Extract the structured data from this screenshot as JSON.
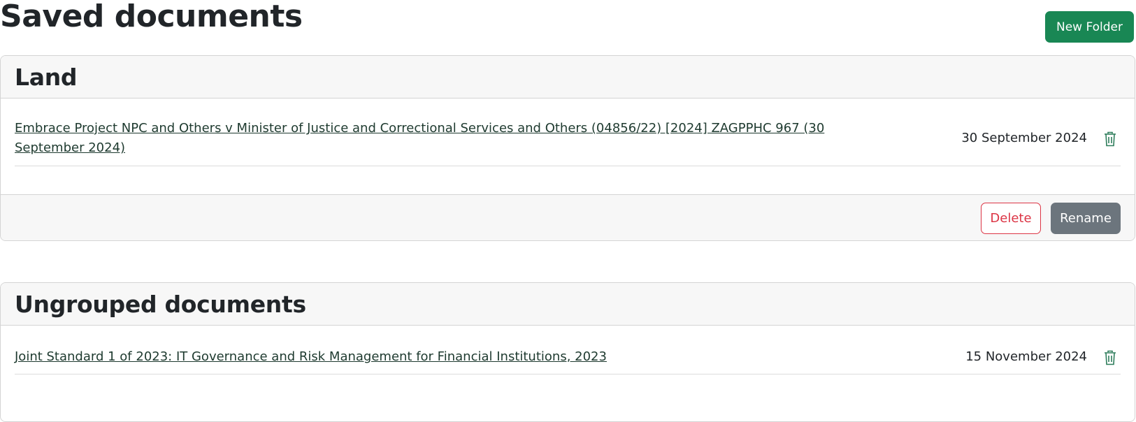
{
  "page": {
    "title": "Saved documents",
    "new_folder_label": "New Folder"
  },
  "colors": {
    "primary_green": "#198754",
    "danger_red": "#dc3545",
    "secondary_gray": "#6c757d",
    "link_color": "#1e3a2f",
    "icon_color": "#2e7d5b"
  },
  "folders": [
    {
      "name": "Land",
      "documents": [
        {
          "title": "Embrace Project NPC and Others v Minister of Justice and Correctional Services and Others (04856/22) [2024] ZAGPPHC 967 (30 September 2024)",
          "date": "30 September 2024",
          "action_icon": "trash-icon"
        }
      ],
      "actions": {
        "delete_label": "Delete",
        "rename_label": "Rename"
      }
    }
  ],
  "ungrouped": {
    "name": "Ungrouped documents",
    "documents": [
      {
        "title": "Joint Standard 1 of 2023: IT Governance and Risk Management for Financial Institutions, 2023",
        "date": "15 November 2024",
        "action_icon": "trash-icon"
      }
    ]
  }
}
